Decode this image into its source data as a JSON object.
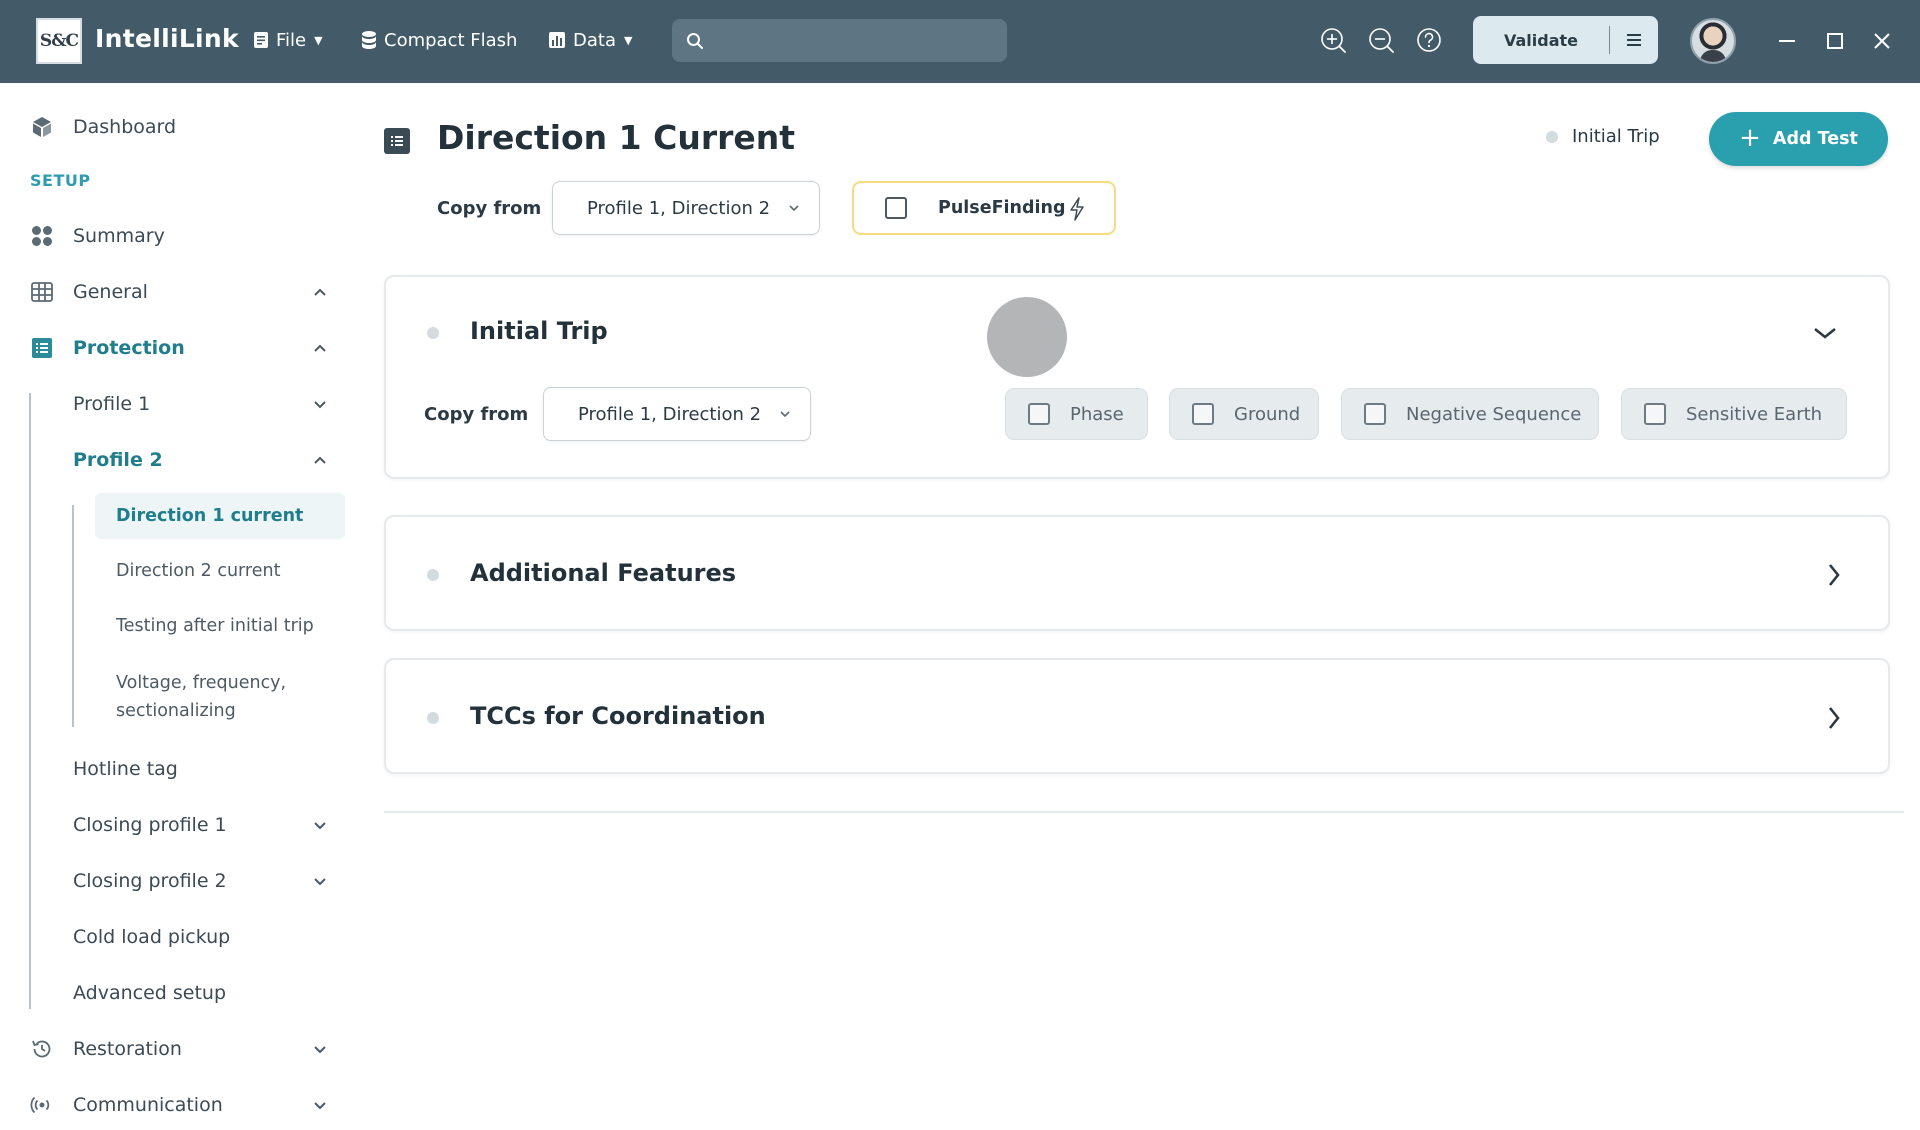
{
  "titlebar": {
    "logo_text": "S&C",
    "app_name": "IntelliLink",
    "menus": [
      {
        "label": "File",
        "icon": "file-icon"
      },
      {
        "label": "Compact Flash",
        "icon": "database-icon"
      },
      {
        "label": "Data",
        "icon": "bar-chart-icon"
      }
    ],
    "search": {
      "value": "",
      "placeholder": ""
    },
    "validate_label": "Validate",
    "icons": [
      "zoom-in-icon",
      "zoom-out-icon",
      "help-icon",
      "menu-icon",
      "minimize-icon",
      "maximize-icon",
      "close-icon"
    ]
  },
  "sidebar": {
    "dashboard": "Dashboard",
    "section_setup": "SETUP",
    "summary": "Summary",
    "general": "General",
    "protection": "Protection",
    "profile1": "Profile 1",
    "profile2": "Profile 2",
    "profile2_children": [
      "Direction 1 current",
      "Direction 2 current",
      "Testing after initial trip",
      "Voltage, frequency, sectionalizing"
    ],
    "hotline_tag": "Hotline tag",
    "closing_profile1": "Closing profile 1",
    "closing_profile2": "Closing profile 2",
    "cold_load_pickup": "Cold load pickup",
    "advanced_setup": "Advanced setup",
    "restoration": "Restoration",
    "communication": "Communication"
  },
  "main": {
    "title": "Direction 1 Current",
    "status_label": "Initial Trip",
    "add_test_label": "Add Test",
    "copy_from_label": "Copy from",
    "copy_from_value": "Profile 1, Direction 2",
    "pulsefinding_label": "PulseFinding",
    "pulsefinding_checked": false,
    "cards": {
      "initial_trip": {
        "title": "Initial Trip",
        "copy_from_label": "Copy from",
        "copy_from_value": "Profile 1, Direction 2",
        "options": [
          "Phase",
          "Ground",
          "Negative Sequence",
          "Sensitive Earth"
        ]
      },
      "additional_features": {
        "title": "Additional Features"
      },
      "tccs": {
        "title": "TCCs for Coordination"
      }
    }
  },
  "colors": {
    "titlebar_bg": "#435b69",
    "accent": "#2a9fae",
    "active_text": "#1f7d8c",
    "section_label": "#2d9bb0",
    "pulse_border": "#f5dc82"
  }
}
